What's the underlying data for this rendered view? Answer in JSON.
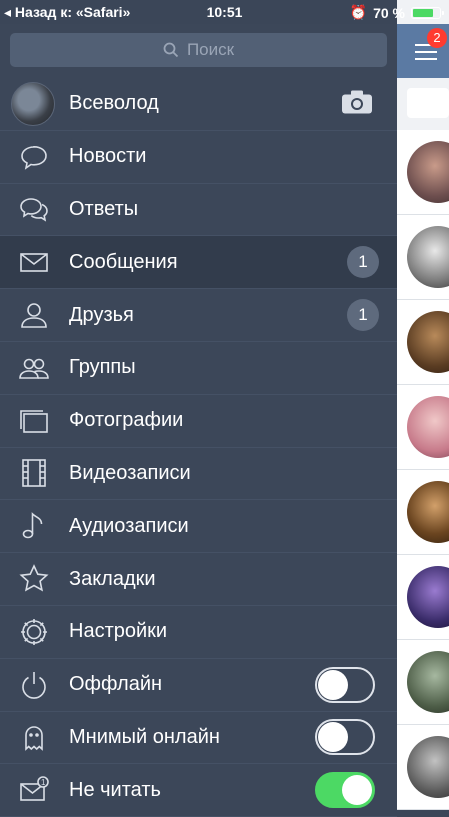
{
  "status_bar": {
    "back": "◂ Назад к: «Safari»",
    "time": "10:51",
    "battery": "70 %"
  },
  "search": {
    "placeholder": "Поиск"
  },
  "profile": {
    "name": "Всеволод"
  },
  "menu": [
    {
      "label": "Новости",
      "icon": "news-icon"
    },
    {
      "label": "Ответы",
      "icon": "replies-icon"
    },
    {
      "label": "Сообщения",
      "icon": "envelope-icon",
      "badge": "1",
      "active": true
    },
    {
      "label": "Друзья",
      "icon": "person-icon",
      "badge": "1"
    },
    {
      "label": "Группы",
      "icon": "group-icon"
    },
    {
      "label": "Фотографии",
      "icon": "photos-icon"
    },
    {
      "label": "Видеозаписи",
      "icon": "film-icon"
    },
    {
      "label": "Аудиозаписи",
      "icon": "music-icon"
    },
    {
      "label": "Закладки",
      "icon": "star-icon"
    },
    {
      "label": "Настройки",
      "icon": "gear-icon"
    },
    {
      "label": "Оффлайн",
      "icon": "power-icon",
      "toggle": false
    },
    {
      "label": "Мнимый онлайн",
      "icon": "ghost-icon",
      "toggle": false
    },
    {
      "label": "Не читать",
      "icon": "unread-mail-icon",
      "toggle": true
    }
  ],
  "right_panel": {
    "notification_count": "2"
  },
  "colors": {
    "drawer": "#3c4759",
    "active_row": "#323c4c",
    "toggle_on": "#4cd964",
    "header": "#5b7aa3",
    "badge_red": "#ff3b30"
  }
}
